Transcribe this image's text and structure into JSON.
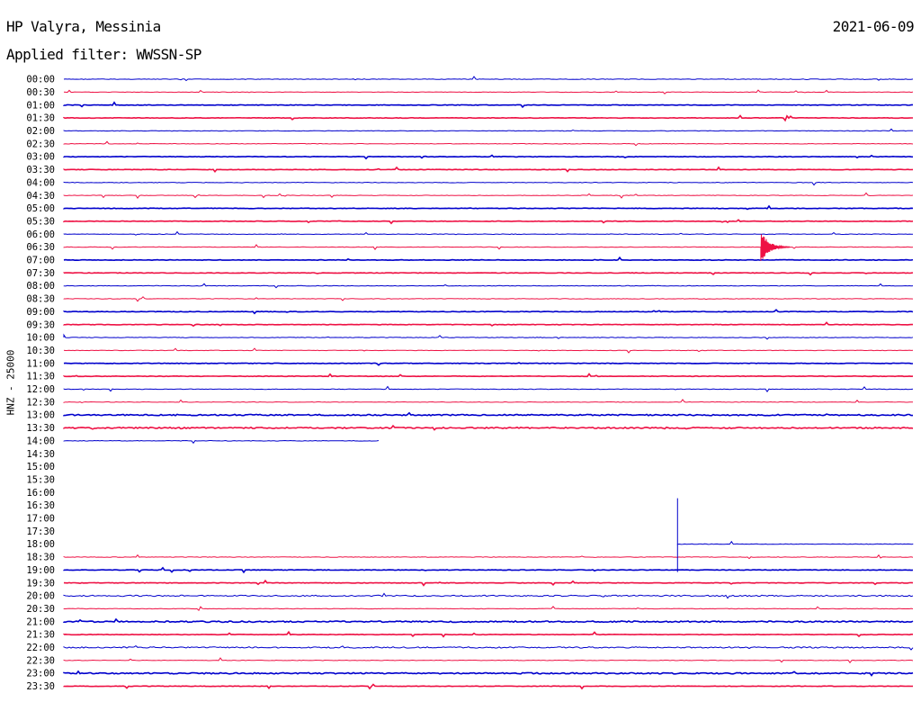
{
  "header": {
    "station": "HP Valyra, Messinia",
    "filter": "Applied filter: WWSSN-SP",
    "date": "2021-06-09"
  },
  "chart_data": {
    "type": "line",
    "title": "HP Valyra, Messinia",
    "subtitle": "Applied filter: WWSSN-SP",
    "ylabel": "HNZ - 25000",
    "xlabel": "",
    "colors": [
      "#0000cc",
      "#ee1144"
    ],
    "rows": [
      {
        "label": "00:00",
        "color": "#0000cc",
        "visible": true
      },
      {
        "label": "00:30",
        "color": "#ee1144",
        "visible": true
      },
      {
        "label": "01:00",
        "color": "#0000cc",
        "visible": true
      },
      {
        "label": "01:30",
        "color": "#ee1144",
        "visible": true
      },
      {
        "label": "02:00",
        "color": "#0000cc",
        "visible": true
      },
      {
        "label": "02:30",
        "color": "#ee1144",
        "visible": true
      },
      {
        "label": "03:00",
        "color": "#0000cc",
        "visible": true
      },
      {
        "label": "03:30",
        "color": "#ee1144",
        "visible": true
      },
      {
        "label": "04:00",
        "color": "#0000cc",
        "visible": true
      },
      {
        "label": "04:30",
        "color": "#ee1144",
        "visible": true
      },
      {
        "label": "05:00",
        "color": "#0000cc",
        "visible": true
      },
      {
        "label": "05:30",
        "color": "#ee1144",
        "visible": true
      },
      {
        "label": "06:00",
        "color": "#0000cc",
        "visible": true
      },
      {
        "label": "06:30",
        "color": "#ee1144",
        "visible": true
      },
      {
        "label": "07:00",
        "color": "#0000cc",
        "visible": true
      },
      {
        "label": "07:30",
        "color": "#ee1144",
        "visible": true
      },
      {
        "label": "08:00",
        "color": "#0000cc",
        "visible": true
      },
      {
        "label": "08:30",
        "color": "#ee1144",
        "visible": true
      },
      {
        "label": "09:00",
        "color": "#0000cc",
        "visible": true
      },
      {
        "label": "09:30",
        "color": "#ee1144",
        "visible": true
      },
      {
        "label": "10:00",
        "color": "#0000cc",
        "visible": true
      },
      {
        "label": "10:30",
        "color": "#ee1144",
        "visible": true
      },
      {
        "label": "11:00",
        "color": "#0000cc",
        "visible": true
      },
      {
        "label": "11:30",
        "color": "#ee1144",
        "visible": true
      },
      {
        "label": "12:00",
        "color": "#0000cc",
        "visible": true
      },
      {
        "label": "12:30",
        "color": "#ee1144",
        "visible": true
      },
      {
        "label": "13:00",
        "color": "#0000cc",
        "visible": true
      },
      {
        "label": "13:30",
        "color": "#ee1144",
        "visible": true
      },
      {
        "label": "14:00",
        "color": "#0000cc",
        "visible": true,
        "end_fraction": 0.372
      },
      {
        "label": "14:30",
        "visible": false
      },
      {
        "label": "15:00",
        "visible": false
      },
      {
        "label": "15:30",
        "visible": false
      },
      {
        "label": "16:00",
        "visible": false
      },
      {
        "label": "16:30",
        "visible": false
      },
      {
        "label": "17:00",
        "visible": false
      },
      {
        "label": "17:30",
        "visible": false
      },
      {
        "label": "18:00",
        "color": "#0000cc",
        "visible": true,
        "start_fraction": 0.722
      },
      {
        "label": "18:30",
        "color": "#ee1144",
        "visible": true
      },
      {
        "label": "19:00",
        "color": "#0000cc",
        "visible": true
      },
      {
        "label": "19:30",
        "color": "#ee1144",
        "visible": true
      },
      {
        "label": "20:00",
        "color": "#0000cc",
        "visible": true
      },
      {
        "label": "20:30",
        "color": "#ee1144",
        "visible": true
      },
      {
        "label": "21:00",
        "color": "#0000cc",
        "visible": true
      },
      {
        "label": "21:30",
        "color": "#ee1144",
        "visible": true
      },
      {
        "label": "22:00",
        "color": "#0000cc",
        "visible": true
      },
      {
        "label": "22:30",
        "color": "#ee1144",
        "visible": true
      },
      {
        "label": "23:00",
        "color": "#0000cc",
        "visible": true
      },
      {
        "label": "23:30",
        "color": "#ee1144",
        "visible": true
      }
    ],
    "events": [
      {
        "row": "06:30",
        "minute": 24.6,
        "amplitude_rows": 1.3,
        "label": ""
      }
    ],
    "gap": {
      "from": "14:11",
      "to": "18:21"
    }
  }
}
